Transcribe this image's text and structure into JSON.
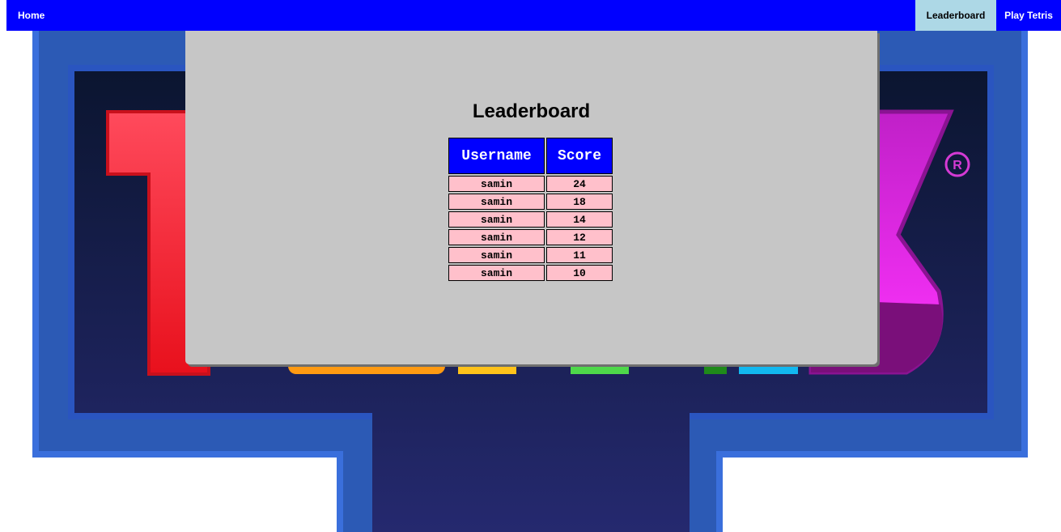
{
  "nav": {
    "home_label": "Home",
    "leaderboard_label": "Leaderboard",
    "play_label": "Play Tetris"
  },
  "leaderboard": {
    "title": "Leaderboard",
    "headers": [
      "Username",
      "Score"
    ],
    "rows": [
      {
        "username": "samin",
        "score": "24"
      },
      {
        "username": "samin",
        "score": "18"
      },
      {
        "username": "samin",
        "score": "14"
      },
      {
        "username": "samin",
        "score": "12"
      },
      {
        "username": "samin",
        "score": "11"
      },
      {
        "username": "samin",
        "score": "10"
      }
    ]
  },
  "background": {
    "logo_mark": "®"
  },
  "colors": {
    "nav_bg": "#0000ff",
    "nav_active_bg": "#add8e6",
    "panel_bg": "#c6c6c6",
    "header_bg": "#0000ff",
    "cell_bg": "#ffc0cb"
  }
}
